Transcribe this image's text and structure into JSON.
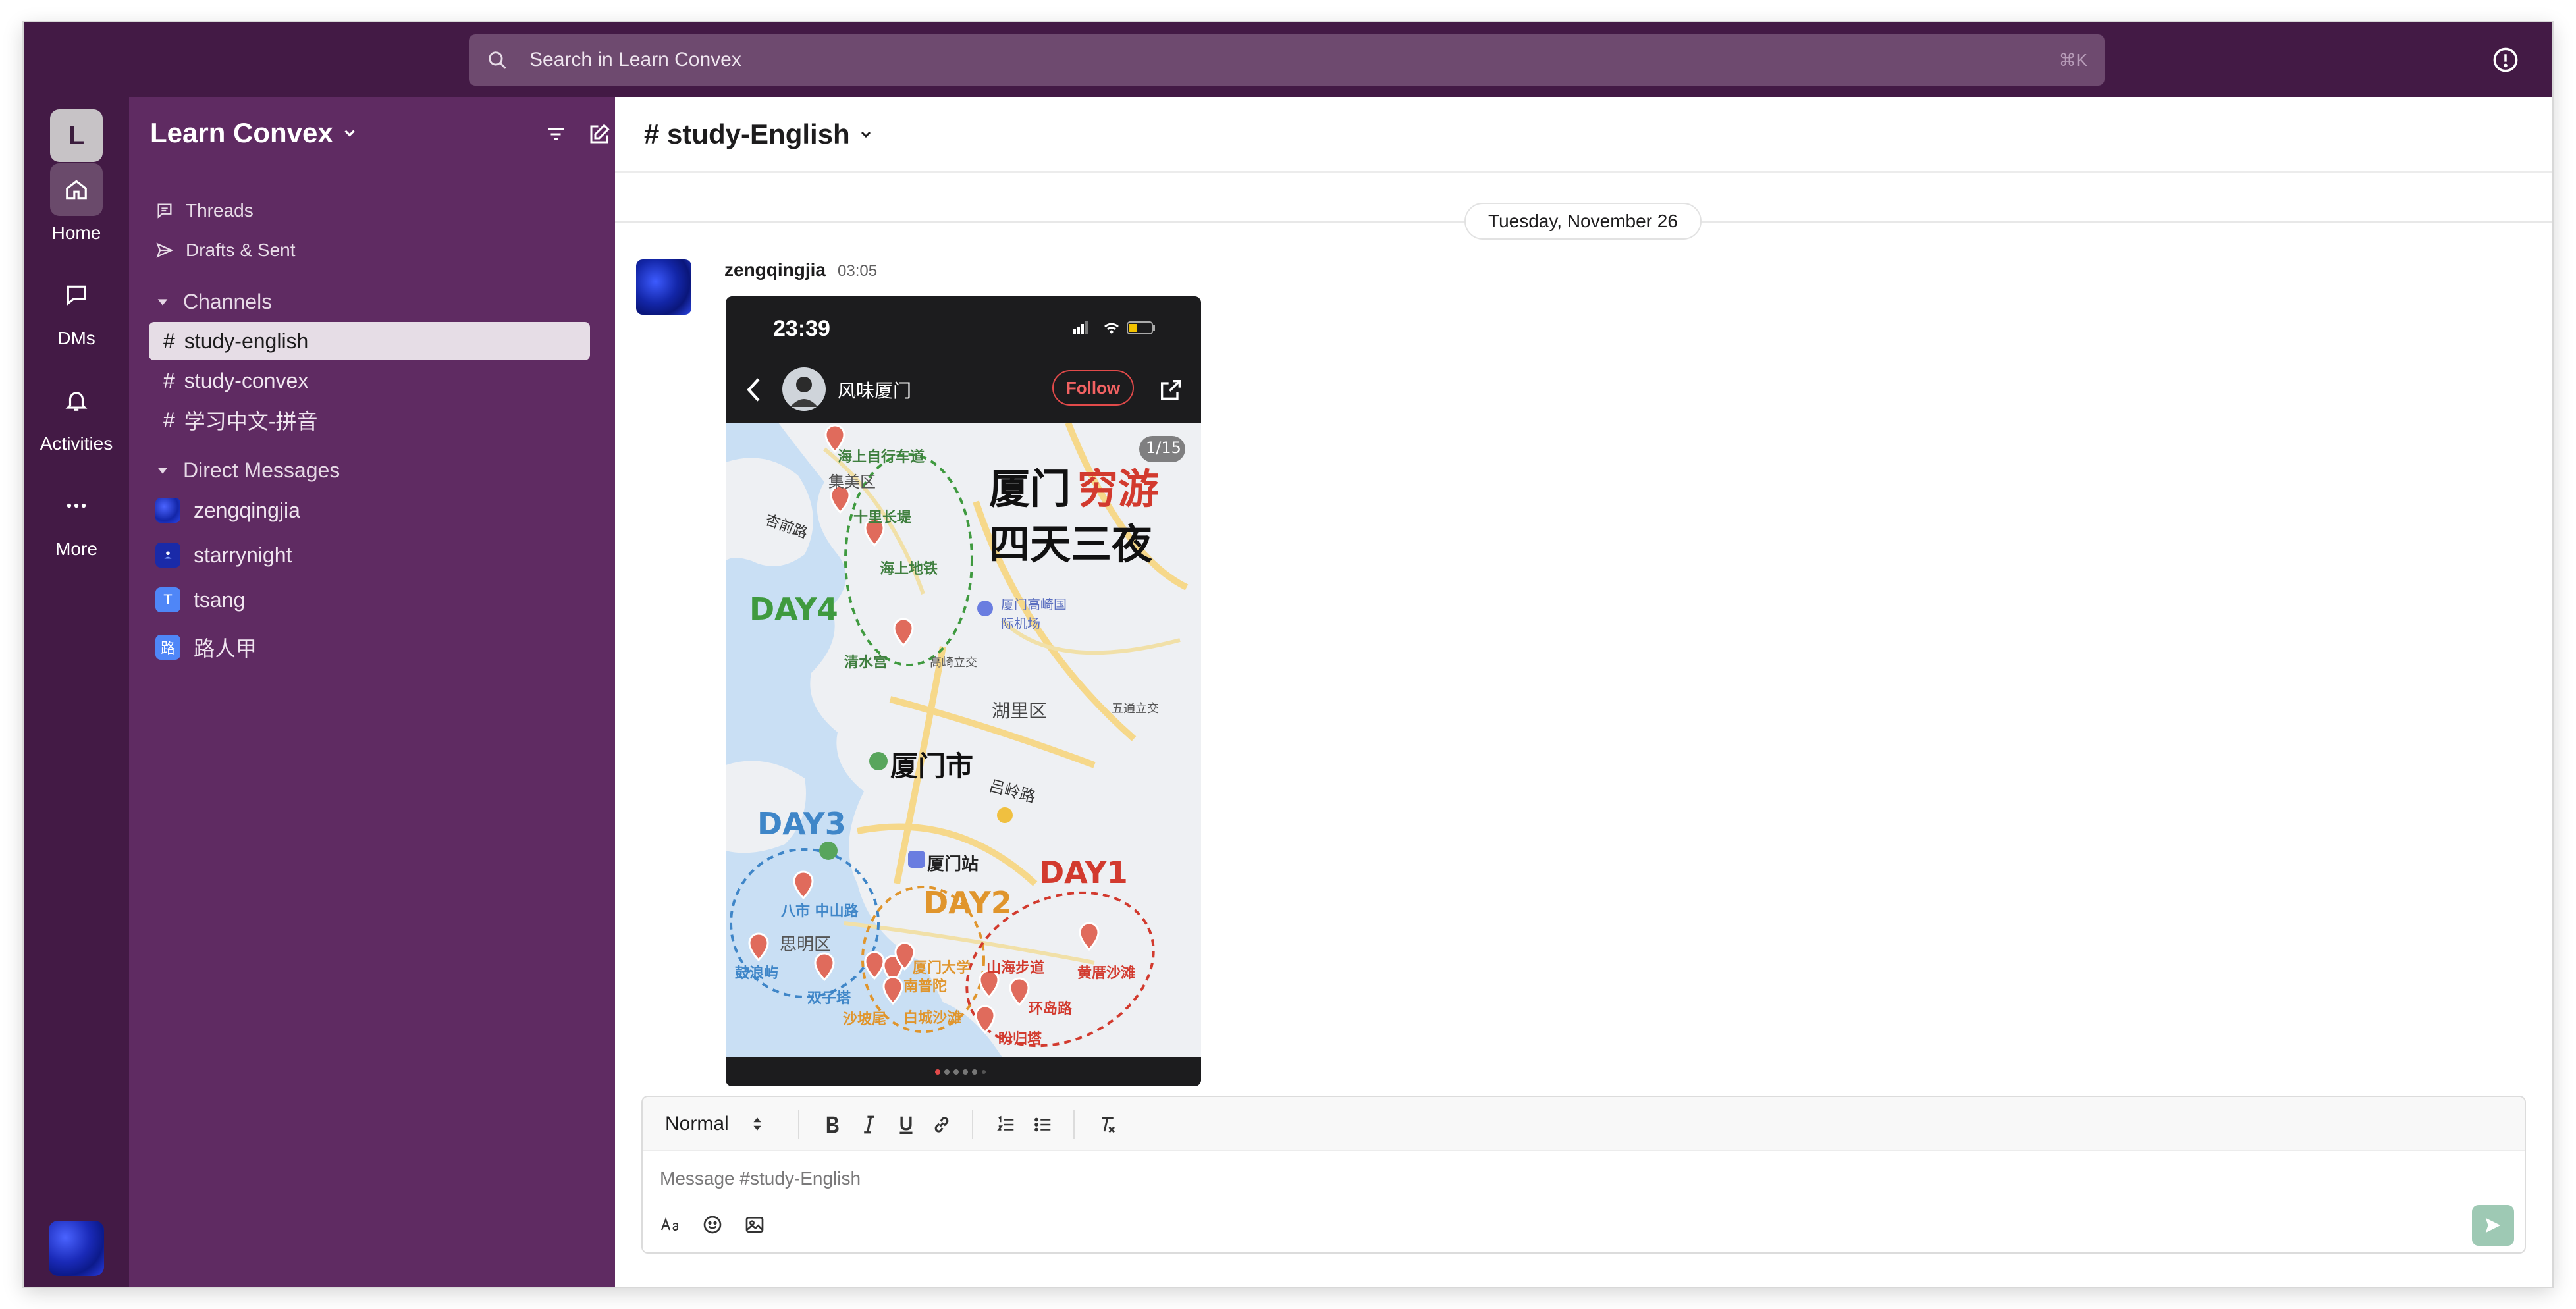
{
  "search": {
    "placeholder": "Search in Learn Convex",
    "shortcut": "⌘K"
  },
  "rail": {
    "workspace_initial": "L",
    "items": [
      {
        "label": "Home",
        "icon": "home-icon"
      },
      {
        "label": "DMs",
        "icon": "chat-icon"
      },
      {
        "label": "Activities",
        "icon": "bell-icon"
      },
      {
        "label": "More",
        "icon": "more-icon"
      }
    ]
  },
  "sidebar": {
    "workspace_name": "Learn Convex",
    "links": [
      {
        "label": "Threads",
        "icon": "threads-icon"
      },
      {
        "label": "Drafts & Sent",
        "icon": "send-icon"
      }
    ],
    "channels_header": "Channels",
    "channels": [
      {
        "label": "study-english",
        "active": true
      },
      {
        "label": "study-convex",
        "active": false
      },
      {
        "label": "学习中文-拼音",
        "active": false
      }
    ],
    "dm_header": "Direct Messages",
    "dms": [
      {
        "label": "zengqingjia",
        "initial": "",
        "color": "#2b3fd6"
      },
      {
        "label": "starrynight",
        "initial": "",
        "color": "#1a2aa8"
      },
      {
        "label": "tsang",
        "initial": "T",
        "color": "#4f86f7"
      },
      {
        "label": "路人甲",
        "initial": "路",
        "color": "#4f86f7"
      }
    ]
  },
  "channel": {
    "title": "# study-English",
    "date": "Tuesday, November 26"
  },
  "message": {
    "author": "zengqingjia",
    "time": "03:05",
    "screenshot": {
      "status_time": "23:39",
      "account": "风味厦门",
      "follow": "Follow",
      "counter": "1/15",
      "title_line1_a": "厦门",
      "title_line1_b": "穷游",
      "title_line2": "四天三夜",
      "city": "厦门市",
      "days": [
        {
          "label": "DAY4",
          "color": "#3f9a3f"
        },
        {
          "label": "DAY3",
          "color": "#3f86c8"
        },
        {
          "label": "DAY2",
          "color": "#e0952c"
        },
        {
          "label": "DAY1",
          "color": "#d23a2e"
        }
      ],
      "places": [
        "海上自行车道",
        "集美区",
        "杏前路",
        "十里长堤",
        "海上地铁",
        "厦门高崎国际机场",
        "清水宫",
        "高崎立交",
        "湖里区",
        "五通立交",
        "吕岭路",
        "厦门站",
        "八市 中山路",
        "思明区",
        "鼓浪屿",
        "双子塔",
        "沙坡尾",
        "厦门大学",
        "南普陀",
        "白城沙滩",
        "山海步道",
        "环岛路",
        "黄厝沙滩",
        "盼归塔"
      ]
    }
  },
  "composer": {
    "format": "Normal",
    "placeholder": "Message #study-English"
  }
}
